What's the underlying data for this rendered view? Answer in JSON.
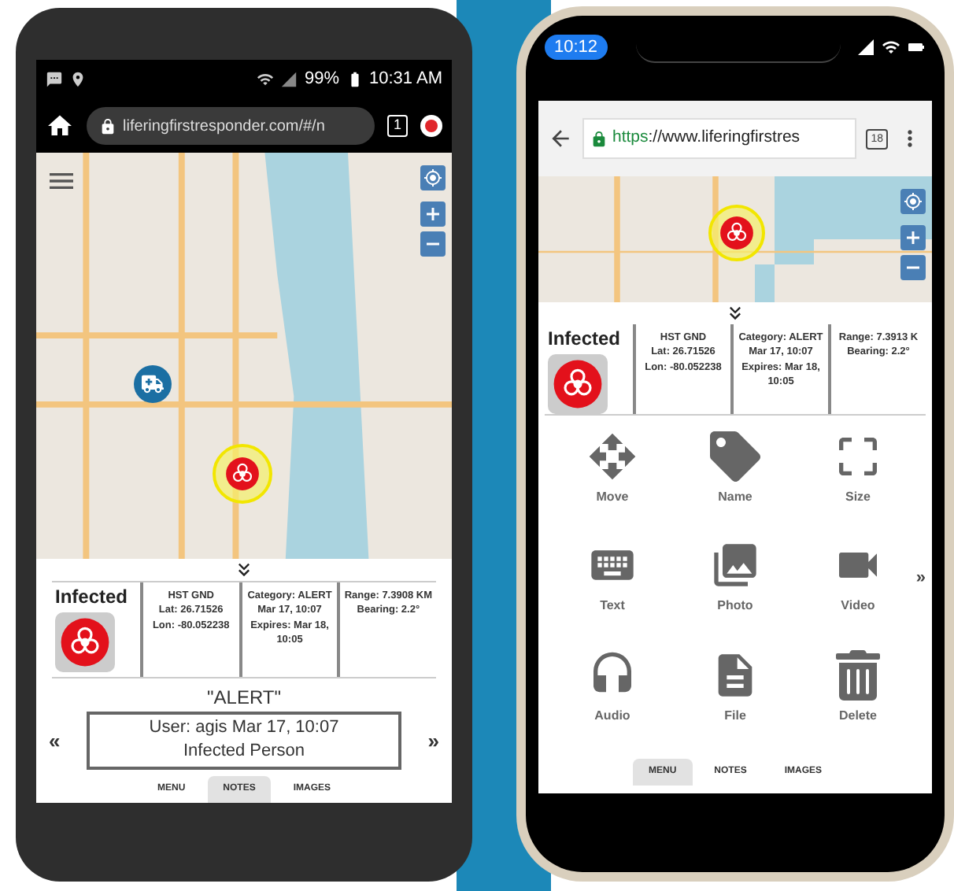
{
  "left_phone": {
    "status_bar": {
      "battery": "99%",
      "time": "10:31 AM"
    },
    "address_bar": {
      "url": "liferingfirstresponder.com/#/n",
      "tab_count": "1"
    },
    "info": {
      "title": "Infected",
      "columns": [
        [
          "HST GND",
          "Lat: 26.71526",
          "Lon: -80.052238"
        ],
        [
          "Category: ALERT",
          "Mar 17, 10:07",
          "Expires: Mar 18,",
          "10:05"
        ],
        [
          "Range: 7.3908 KM",
          "Bearing: 2.2°"
        ]
      ]
    },
    "note": {
      "title": "\"ALERT\"",
      "prev": "«",
      "next": "»",
      "lines": [
        "User: agis Mar 17, 10:07",
        "Infected Person"
      ]
    },
    "tabs": [
      {
        "label": "MENU",
        "selected": false
      },
      {
        "label": "NOTES",
        "selected": true
      },
      {
        "label": "IMAGES",
        "selected": false
      }
    ]
  },
  "right_phone": {
    "status_bar": {
      "time": "10:12"
    },
    "address_bar": {
      "scheme": "https",
      "rest": "://www.liferingfirstres",
      "tab_count": "18"
    },
    "info": {
      "title": "Infected",
      "columns": [
        [
          "HST GND",
          "Lat: 26.71526",
          "Lon: -80.052238"
        ],
        [
          "Category: ALERT",
          "Mar 17, 10:07",
          "Expires: Mar 18,",
          "10:05"
        ],
        [
          "Range: 7.3913 K",
          "Bearing: 2.2°"
        ]
      ]
    },
    "menu_items": [
      {
        "kind": "move",
        "label": "Move"
      },
      {
        "kind": "tag",
        "label": "Name"
      },
      {
        "kind": "size",
        "label": "Size"
      },
      {
        "kind": "keyboard",
        "label": "Text"
      },
      {
        "kind": "photo",
        "label": "Photo"
      },
      {
        "kind": "video",
        "label": "Video"
      },
      {
        "kind": "headphones",
        "label": "Audio"
      },
      {
        "kind": "file",
        "label": "File"
      },
      {
        "kind": "trash",
        "label": "Delete"
      }
    ],
    "more": "»",
    "tabs": [
      {
        "label": "MENU",
        "selected": true
      },
      {
        "label": "NOTES",
        "selected": false
      },
      {
        "label": "IMAGES",
        "selected": false
      }
    ]
  }
}
